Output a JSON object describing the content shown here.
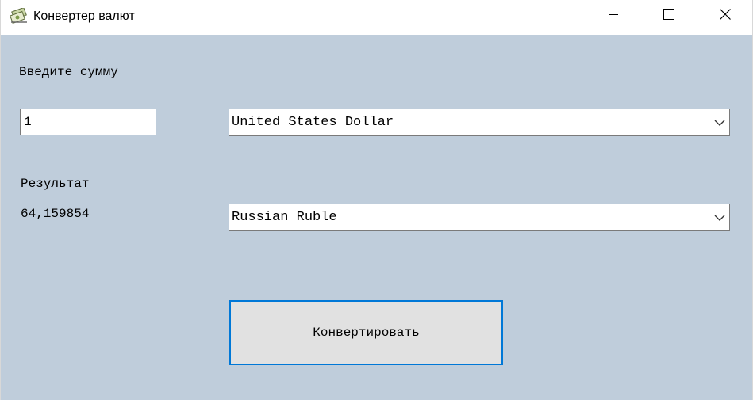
{
  "window": {
    "title": "Конвертер валют",
    "icon": "currency-converter-app-icon",
    "controls": {
      "minimize_icon": "minimize-icon",
      "maximize_icon": "maximize-icon",
      "close_icon": "close-icon"
    }
  },
  "form": {
    "amount_label": "Введите сумму",
    "amount_value": "1",
    "from_currency": "United States Dollar",
    "result_label": "Результат",
    "result_value": "64,159854",
    "to_currency": "Russian Ruble",
    "convert_button": "Конвертировать"
  },
  "colors": {
    "client_background": "#bfcddb",
    "button_focus_border": "#0078d7",
    "button_face": "#e1e1e1"
  }
}
